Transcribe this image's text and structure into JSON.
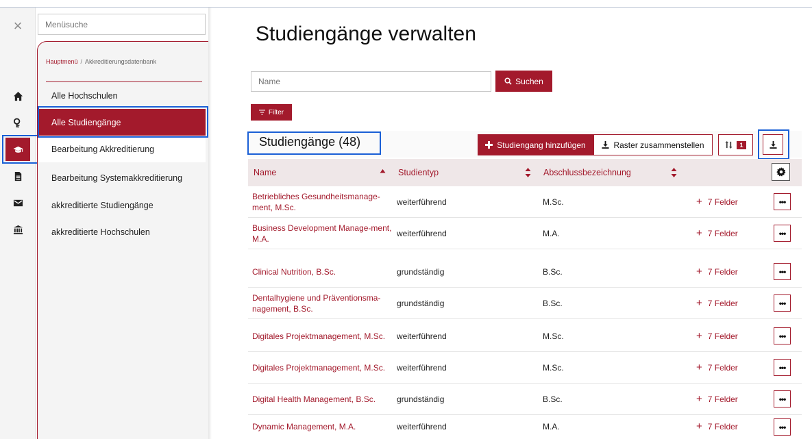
{
  "sidebar": {
    "close_symbol": "×",
    "rail_icons": [
      "home-icon",
      "key-icon",
      "graduation-cap-icon",
      "document-icon",
      "mail-icon",
      "bank-icon"
    ],
    "search_placeholder": "Menüsuche",
    "breadcrumb": {
      "home": "Hauptmenü",
      "separator": "/",
      "current": "Akkreditierungsdatenbank"
    },
    "items": [
      {
        "label": "Alle Hochschulen"
      },
      {
        "label": "Alle Studiengänge",
        "active": true
      },
      {
        "label": "Bearbeitung Akkreditierung"
      },
      {
        "label": "Bearbeitung Systemakkreditierung"
      },
      {
        "label": "akkreditierte Studiengänge"
      },
      {
        "label": "akkreditierte Hochschulen"
      }
    ]
  },
  "main": {
    "title": "Studiengänge verwalten",
    "search": {
      "placeholder": "Name",
      "button_label": "Suchen"
    },
    "filter_label": "Filter",
    "count_title": "Studiengänge (48)",
    "add_button_label": "Studiengang hinzufügen",
    "raster_button_label": "Raster zusammenstellen",
    "sort_badge": "1",
    "columns": [
      "Name",
      "Studientyp",
      "Abschlussbezeichnung"
    ],
    "rows": [
      {
        "name": "Betriebliches Gesundheitsmanage-ment, M.Sc.",
        "typ": "weiterführend",
        "abschluss": "M.Sc.",
        "felder": "7 Felder"
      },
      {
        "name": "Business Development Manage-ment, M.A.",
        "typ": "weiterführend",
        "abschluss": "M.A.",
        "felder": "7 Felder"
      },
      {
        "name": "Clinical Nutrition, B.Sc.",
        "typ": "grundständig",
        "abschluss": "B.Sc.",
        "felder": "7 Felder"
      },
      {
        "name": "Dentalhygiene und Präventionsma-nagement, B.Sc.",
        "typ": "grundständig",
        "abschluss": "B.Sc.",
        "felder": "7 Felder"
      },
      {
        "name": "Digitales Projektmanagement, M.Sc.",
        "typ": "weiterführend",
        "abschluss": "M.Sc.",
        "felder": "7 Felder"
      },
      {
        "name": "Digitales Projektmanagement, M.Sc.",
        "typ": "weiterführend",
        "abschluss": "M.Sc.",
        "felder": "7 Felder"
      },
      {
        "name": "Digital Health Management, B.Sc.",
        "typ": "grundständig",
        "abschluss": "B.Sc.",
        "felder": "7 Felder"
      },
      {
        "name": "Dynamic Management, M.A.",
        "typ": "weiterführend",
        "abschluss": "M.A.",
        "felder": "7 Felder"
      }
    ],
    "more_symbol": "•••"
  },
  "colors": {
    "accent": "#a31a2c",
    "highlight": "#1a5fd6",
    "panel": "#f4f4f4",
    "header_bg": "#efe7e8"
  }
}
